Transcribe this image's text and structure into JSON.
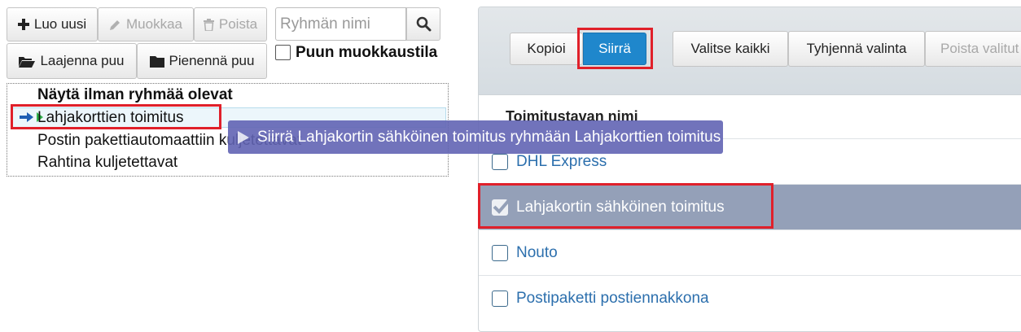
{
  "left_toolbar": {
    "new_label": "Luo uusi",
    "edit_label": "Muokkaa",
    "delete_label": "Poista",
    "search_placeholder": "Ryhmän nimi",
    "expand_label": "Laajenna puu",
    "collapse_label": "Pienennä puu",
    "edit_mode_label": "Puun muokkaustila"
  },
  "tree": {
    "header": "Näytä ilman ryhmää olevat",
    "items": [
      {
        "label": "Lahjakorttien toimitus"
      },
      {
        "label": "Postin pakettiautomaattiin kuljetettavat"
      },
      {
        "label": "Rahtina kuljetettavat"
      }
    ]
  },
  "drag_tooltip": "Siirrä Lahjakortin sähköinen toimitus ryhmään Lahjakorttien toimitus",
  "right_toolbar": {
    "copy_label": "Kopioi",
    "move_label": "Siirrä",
    "select_all_label": "Valitse kaikki",
    "clear_selection_label": "Tyhjennä valinta",
    "remove_selection_label": "Poista valitut"
  },
  "list": {
    "column_header": "Toimitustavan nimi",
    "rows": [
      {
        "label": "DHL Express",
        "checked": false
      },
      {
        "label": "Lahjakortin sähköinen toimitus",
        "checked": true
      },
      {
        "label": "Nouto",
        "checked": false
      },
      {
        "label": "Postipaketti postiennakkona",
        "checked": false
      }
    ]
  },
  "colors": {
    "accent_blue": "#1f87cc",
    "selected_row": "#94a0b8",
    "tooltip": "#6264b4",
    "highlight_red": "#e0202a",
    "link_blue": "#2c6fad"
  }
}
